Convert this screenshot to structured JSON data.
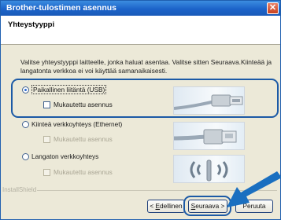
{
  "window": {
    "title": "Brother-tulostimen asennus",
    "close_glyph": "✕"
  },
  "header": {
    "title": "Yhteystyyppi"
  },
  "intro": {
    "text": "Valitse yhteystyyppi laitteelle, jonka haluat asentaa. Valitse sitten Seuraava.Kiinteää ja langatonta verkkoa ei voi käyttää samanaikaisesti."
  },
  "options": [
    {
      "label": "Paikallinen liitäntä (USB)",
      "selected": true,
      "checkbox_label": "Mukautettu asennus",
      "checkbox_enabled": true,
      "icon": "usb-cable-icon"
    },
    {
      "label": "Kiinteä verkkoyhteys (Ethernet)",
      "selected": false,
      "checkbox_label": "Mukautettu asennus",
      "checkbox_enabled": false,
      "icon": "ethernet-cable-icon"
    },
    {
      "label": "Langaton verkkoyhteys",
      "selected": false,
      "checkbox_label": "Mukautettu asennus",
      "checkbox_enabled": false,
      "icon": "wireless-icon"
    }
  ],
  "footer": {
    "brand": "InstallShield",
    "back_prefix": "< ",
    "back_mnemonic": "E",
    "back_rest": "dellinen",
    "next_mnemonic": "S",
    "next_rest": "euraava >",
    "cancel_label": "Peruuta"
  },
  "colors": {
    "highlight": "#1c5aa6",
    "arrow": "#1a6fc0",
    "titlebar": "#1c63c9"
  }
}
